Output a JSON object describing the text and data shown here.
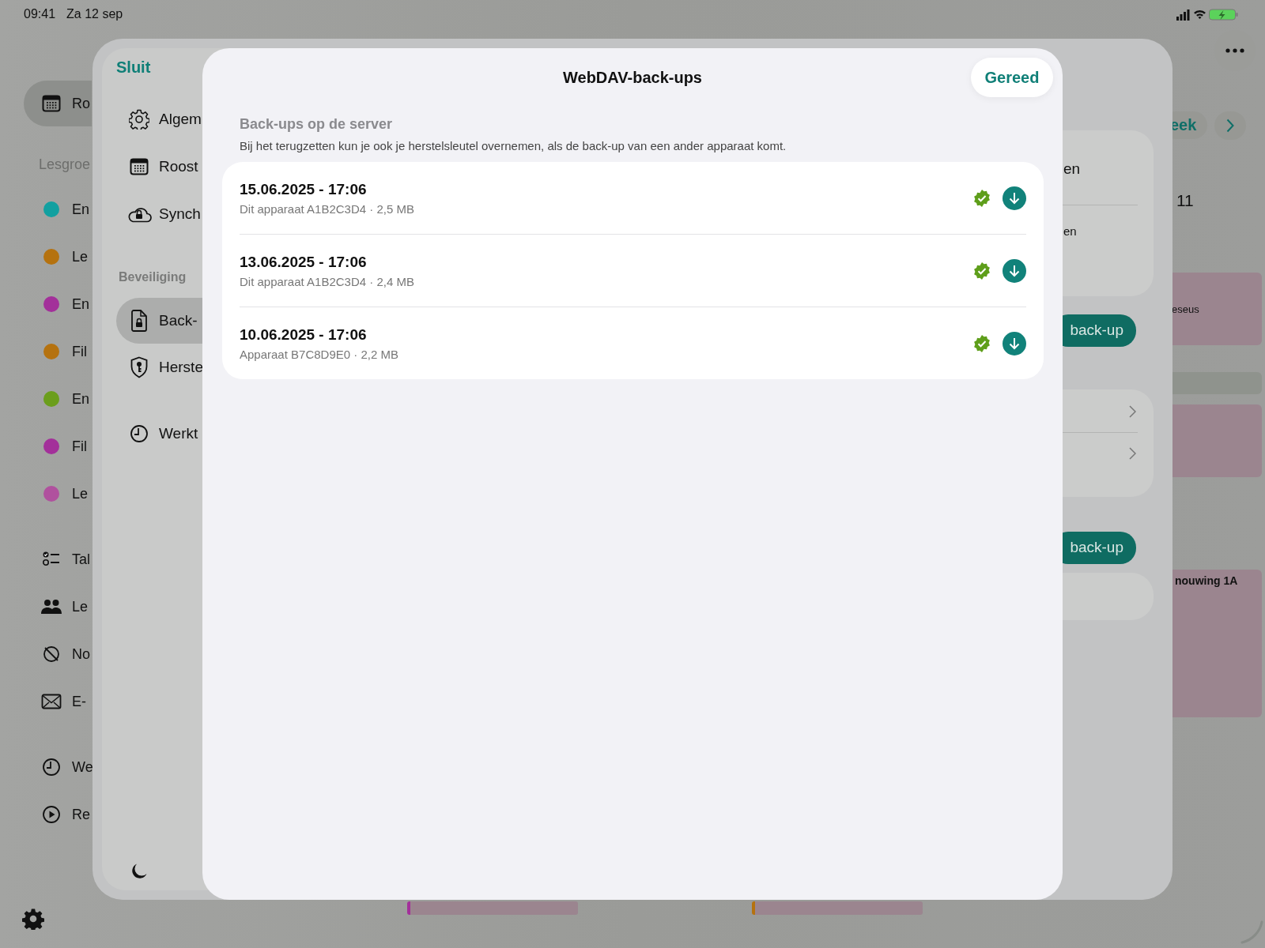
{
  "status_bar": {
    "time": "09:41",
    "date": "Za 12 sep"
  },
  "sidebar": {
    "sections": [
      {
        "items": [
          {
            "kind": "nav",
            "label": "Ro",
            "selected": true
          }
        ]
      },
      {
        "header": "Lesgroe",
        "items": [
          {
            "kind": "group",
            "label": "En",
            "color": "#12a0a0"
          },
          {
            "kind": "group",
            "label": "Le",
            "color": "#b5720f"
          },
          {
            "kind": "group",
            "label": "En",
            "color": "#a3309a"
          },
          {
            "kind": "group",
            "label": "Fil",
            "color": "#b5720f"
          },
          {
            "kind": "group",
            "label": "En",
            "color": "#6b9e1c"
          },
          {
            "kind": "group",
            "label": "Fil",
            "color": "#a3309a"
          },
          {
            "kind": "group",
            "label": "Le",
            "color": "#b0519e"
          }
        ]
      },
      {
        "items": [
          {
            "kind": "nav",
            "label": "Tal",
            "selected": false
          },
          {
            "kind": "nav",
            "label": "Le",
            "selected": false
          },
          {
            "kind": "nav",
            "label": "No",
            "selected": false
          },
          {
            "kind": "nav",
            "label": "E-",
            "selected": false
          }
        ]
      },
      {
        "items": [
          {
            "kind": "nav",
            "label": "We",
            "selected": false
          },
          {
            "kind": "nav",
            "label": "Re",
            "selected": false
          }
        ]
      }
    ]
  },
  "background_right": {
    "week_button": "eek",
    "day_label": "11",
    "card_rows": [
      "en",
      "en"
    ],
    "backup_buttons": [
      "back-up",
      "back-up"
    ],
    "events": [
      "eseus",
      "nouwing 1A"
    ]
  },
  "settings": {
    "close": "Sluit",
    "sections": [
      {
        "items": [
          {
            "label": "Algem",
            "selected": false
          },
          {
            "label": "Roost",
            "selected": false
          },
          {
            "label": "Synch",
            "selected": false
          }
        ]
      },
      {
        "header": "Beveiliging",
        "items": [
          {
            "label": "Back-",
            "selected": true
          },
          {
            "label": "Herste",
            "selected": false
          }
        ]
      },
      {
        "items": [
          {
            "label": "Werkt",
            "selected": false
          }
        ]
      }
    ]
  },
  "modal": {
    "title": "WebDAV-back-ups",
    "done": "Gereed",
    "section_title": "Back-ups op de server",
    "description": "Bij het terugzetten kun je ook je herstelsleutel overnemen, als de back-up van een ander apparaat komt.",
    "backups": [
      {
        "date": "15.06.2025 - 17:06",
        "detail": "Dit apparaat A1B2C3D4 · 2,5 MB",
        "verified": true
      },
      {
        "date": "13.06.2025 - 17:06",
        "detail": "Dit apparaat A1B2C3D4 · 2,4 MB",
        "verified": true
      },
      {
        "date": "10.06.2025 - 17:06",
        "detail": "Apparaat B7C8D9E0 · 2,2 MB",
        "verified": true
      }
    ]
  }
}
